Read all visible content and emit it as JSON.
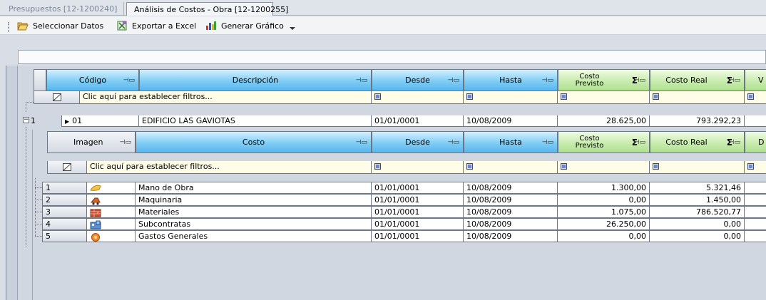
{
  "tabs": [
    {
      "label": "Presupuestos [12-1200240]",
      "active": false
    },
    {
      "label": "Análisis de Costos - Obra [12-1200255]",
      "active": true
    }
  ],
  "toolbar": {
    "select_label": "Seleccionar Datos",
    "export_label": "Exportar a Excel",
    "chart_label": "Generar Gráfico"
  },
  "grid": {
    "columns": {
      "codigo": "Código",
      "descripcion": "Descripción",
      "desde": "Desde",
      "hasta": "Hasta",
      "costo_previsto": "Costo Previsto",
      "costo_real": "Costo Real",
      "next": "V"
    },
    "filter_text": "Clic aquí para establecer filtros...",
    "parent_row": {
      "index": "1",
      "codigo": "01",
      "descripcion": "EDIFICIO LAS GAVIOTAS",
      "desde": "01/01/0001",
      "hasta": "10/08/2009",
      "costo_previsto": "28.625,00",
      "costo_real": "793.292,23"
    },
    "child": {
      "columns": {
        "imagen": "Imagen",
        "costo": "Costo",
        "desde": "Desde",
        "hasta": "Hasta",
        "costo_previsto": "Costo Previsto",
        "costo_real": "Costo Real",
        "next": "D"
      },
      "filter_text": "Clic aquí para establecer filtros...",
      "rows": [
        {
          "index": "1",
          "icon": "hand-icon",
          "costo": "Mano de Obra",
          "desde": "01/01/0001",
          "hasta": "10/08/2009",
          "costo_previsto": "1.300,00",
          "costo_real": "5.321,46"
        },
        {
          "index": "2",
          "icon": "machinery-icon",
          "costo": "Maquinaria",
          "desde": "01/01/0001",
          "hasta": "10/08/2009",
          "costo_previsto": "0,00",
          "costo_real": "1.450,00"
        },
        {
          "index": "3",
          "icon": "materials-icon",
          "costo": "Materiales",
          "desde": "01/01/0001",
          "hasta": "10/08/2009",
          "costo_previsto": "1.075,00",
          "costo_real": "786.520,77"
        },
        {
          "index": "4",
          "icon": "subcontract-icon",
          "costo": "Subcontratas",
          "desde": "01/01/0001",
          "hasta": "10/08/2009",
          "costo_previsto": "26.250,00",
          "costo_real": "0,00"
        },
        {
          "index": "5",
          "icon": "general-expenses-icon",
          "costo": "Gastos Generales",
          "desde": "01/01/0001",
          "hasta": "10/08/2009",
          "costo_previsto": "0,00",
          "costo_real": "0,00"
        }
      ]
    }
  }
}
